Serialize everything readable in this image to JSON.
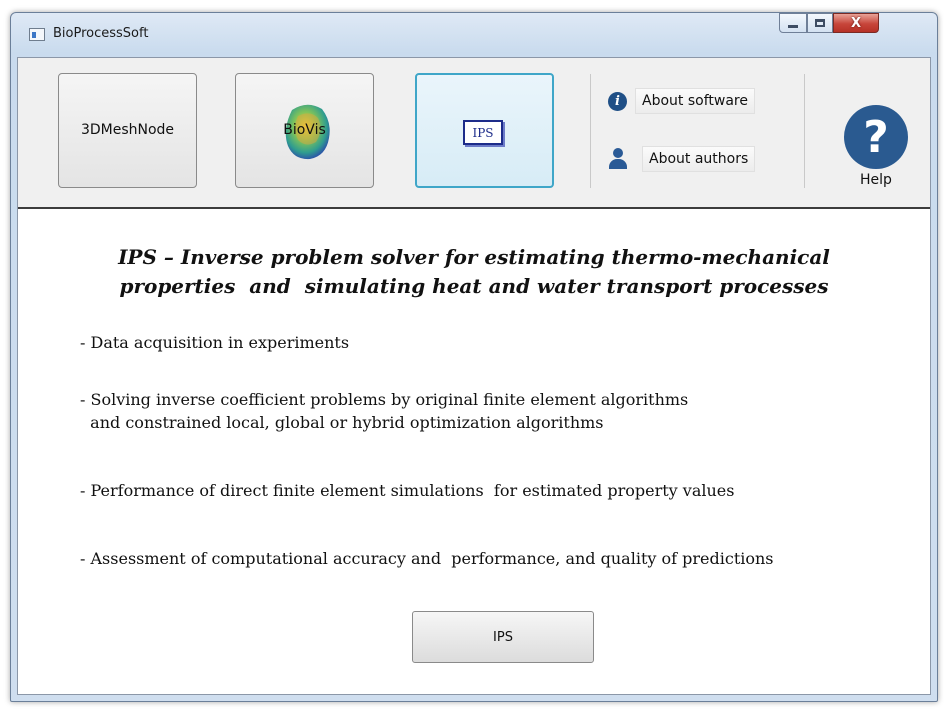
{
  "window": {
    "title": "BioProcessSoft",
    "controls": {
      "minimize_icon": "minimize-icon",
      "maximize_icon": "maximize-icon",
      "close_glyph": "X"
    }
  },
  "toolbar": {
    "modules": [
      {
        "label": "3DMeshNode",
        "icon": null
      },
      {
        "label": "BioVis",
        "icon": "biovis-blob-icon"
      },
      {
        "label": "IPS",
        "icon": "ips-icon",
        "selected": true
      }
    ],
    "links": [
      {
        "label": "About software",
        "icon": "info-icon"
      },
      {
        "label": "About authors",
        "icon": "user-icon"
      }
    ],
    "help": {
      "label": "Help",
      "glyph": "?"
    }
  },
  "content": {
    "heading": [
      "IPS – Inverse problem solver for estimating thermo-mechanical",
      "properties  and  simulating heat and water transport processes"
    ],
    "bullets": [
      "- Data acquisition in experiments",
      "- Solving inverse coefficient problems by original finite element algorithms\n  and constrained local, global or hybrid optimization algorithms",
      "- Performance of direct finite element simulations  for estimated property values",
      "- Assessment of computational accuracy and  performance, and quality of predictions"
    ],
    "run_button": "IPS"
  },
  "colors": {
    "accent_selected": "#3fa6c8",
    "icon_blue": "#2a5a90",
    "close_red": "#c7453a"
  }
}
